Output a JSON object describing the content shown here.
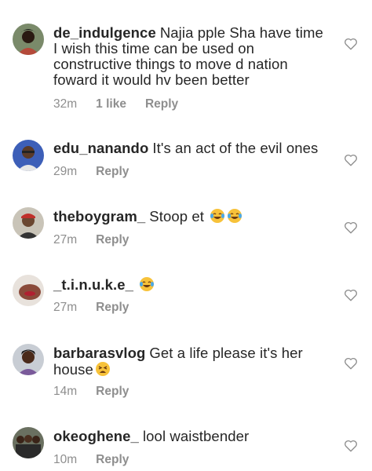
{
  "comments": [
    {
      "username": "de_indulgence",
      "text": "Najia pple Sha have time",
      "text_lines": [
        "I wish this time can be used on",
        "constructive things to move d nation",
        "foward it would hv been better"
      ],
      "time": "32m",
      "likes": "1 like",
      "reply": "Reply"
    },
    {
      "username": "edu_nanando",
      "text": "It's an act of the evil ones",
      "time": "29m",
      "reply": "Reply"
    },
    {
      "username": "theboygram_",
      "text": "Stoop et",
      "emojis": [
        "face-with-tears-of-joy",
        "face-with-tears-of-joy"
      ],
      "time": "27m",
      "reply": "Reply"
    },
    {
      "username": "_t.i.n.u.k.e_",
      "text": "",
      "emojis": [
        "face-with-tears-of-joy"
      ],
      "time": "27m",
      "reply": "Reply"
    },
    {
      "username": "barbarasvlog",
      "text": "Get a life please it's her",
      "text_line2": "house",
      "emojis": [
        "weary-face"
      ],
      "time": "14m",
      "reply": "Reply"
    },
    {
      "username": "okeoghene_",
      "text": "lool waistbender",
      "time": "10m",
      "reply": "Reply"
    }
  ],
  "colors": {
    "text": "#262626",
    "muted": "#8e8e8e",
    "heart_outline": "#8e8e8e",
    "emoji_yellow": "#f7c23a",
    "emoji_tears": "#4aa8e8"
  },
  "icons": {
    "like": "heart-outline-icon",
    "avatar": "user-avatar-photo"
  }
}
